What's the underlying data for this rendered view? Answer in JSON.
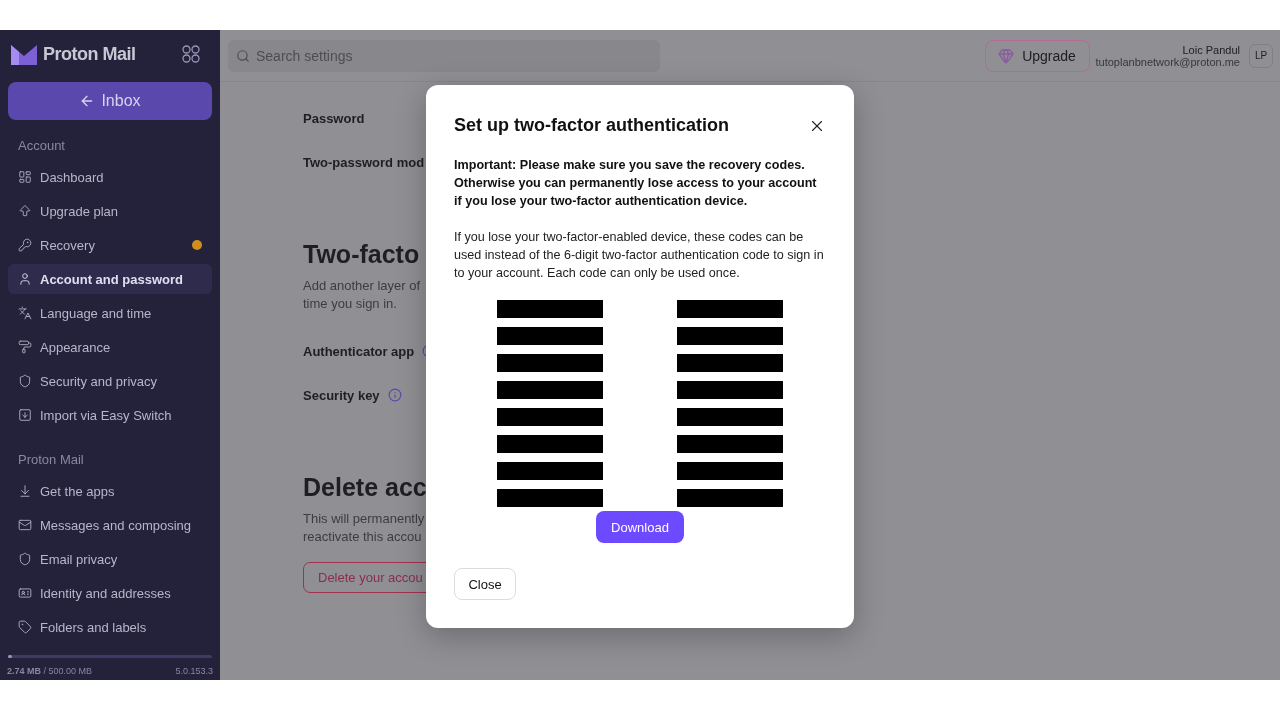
{
  "sidebar": {
    "brand": "Proton Mail",
    "inbox_button": "Inbox",
    "sections": [
      {
        "title": "Account",
        "items": [
          {
            "label": "Dashboard",
            "selected": false,
            "notice": false
          },
          {
            "label": "Upgrade plan",
            "selected": false,
            "notice": false
          },
          {
            "label": "Recovery",
            "selected": false,
            "notice": true
          },
          {
            "label": "Account and password",
            "selected": true,
            "notice": false
          },
          {
            "label": "Language and time",
            "selected": false,
            "notice": false
          },
          {
            "label": "Appearance",
            "selected": false,
            "notice": false
          },
          {
            "label": "Security and privacy",
            "selected": false,
            "notice": false
          },
          {
            "label": "Import via Easy Switch",
            "selected": false,
            "notice": false
          }
        ]
      },
      {
        "title": "Proton Mail",
        "items": [
          {
            "label": "Get the apps",
            "selected": false,
            "notice": false
          },
          {
            "label": "Messages and composing",
            "selected": false,
            "notice": false
          },
          {
            "label": "Email privacy",
            "selected": false,
            "notice": false
          },
          {
            "label": "Identity and addresses",
            "selected": false,
            "notice": false
          },
          {
            "label": "Folders and labels",
            "selected": false,
            "notice": false
          }
        ]
      }
    ],
    "storage": {
      "text": "**2.74 MB** / 500.00 MB",
      "level": 0.02
    },
    "version": "5.0.153.3"
  },
  "header": {
    "search": {
      "placeholder": "Search settings"
    },
    "upgrade_button": "Upgrade",
    "user": {
      "name": "Loic Pandul",
      "email": "tutoplanbnetwork@proton.me",
      "initials": "LP"
    }
  },
  "content": {
    "rows": [
      {
        "label": "Password",
        "info": false
      },
      {
        "label": "Two-password mod",
        "info": false
      }
    ],
    "sections": [
      {
        "heading": "Two-facto",
        "description": [
          "Add another layer of",
          "time you sign in."
        ],
        "rows": [
          {
            "label": "Authenticator app",
            "info": true
          },
          {
            "label": "Security key",
            "info": true
          }
        ]
      },
      {
        "heading": "Delete acc",
        "description": [
          "This will permanently",
          "reactivate this accou"
        ],
        "button": "Delete your accou"
      }
    ]
  },
  "modal": {
    "title": "Set up two-factor authentication",
    "warning": "Important: Please make sure you save the recovery codes. Otherwise you can permanently lose access to your account if you lose your two-factor authentication device.",
    "info": "If you lose your two-factor-enabled device, these codes can be used instead of the 6-digit two-factor authentication code to sign in to your account. Each code can only be used once.",
    "download_button": "Download",
    "close_button": "Close"
  }
}
